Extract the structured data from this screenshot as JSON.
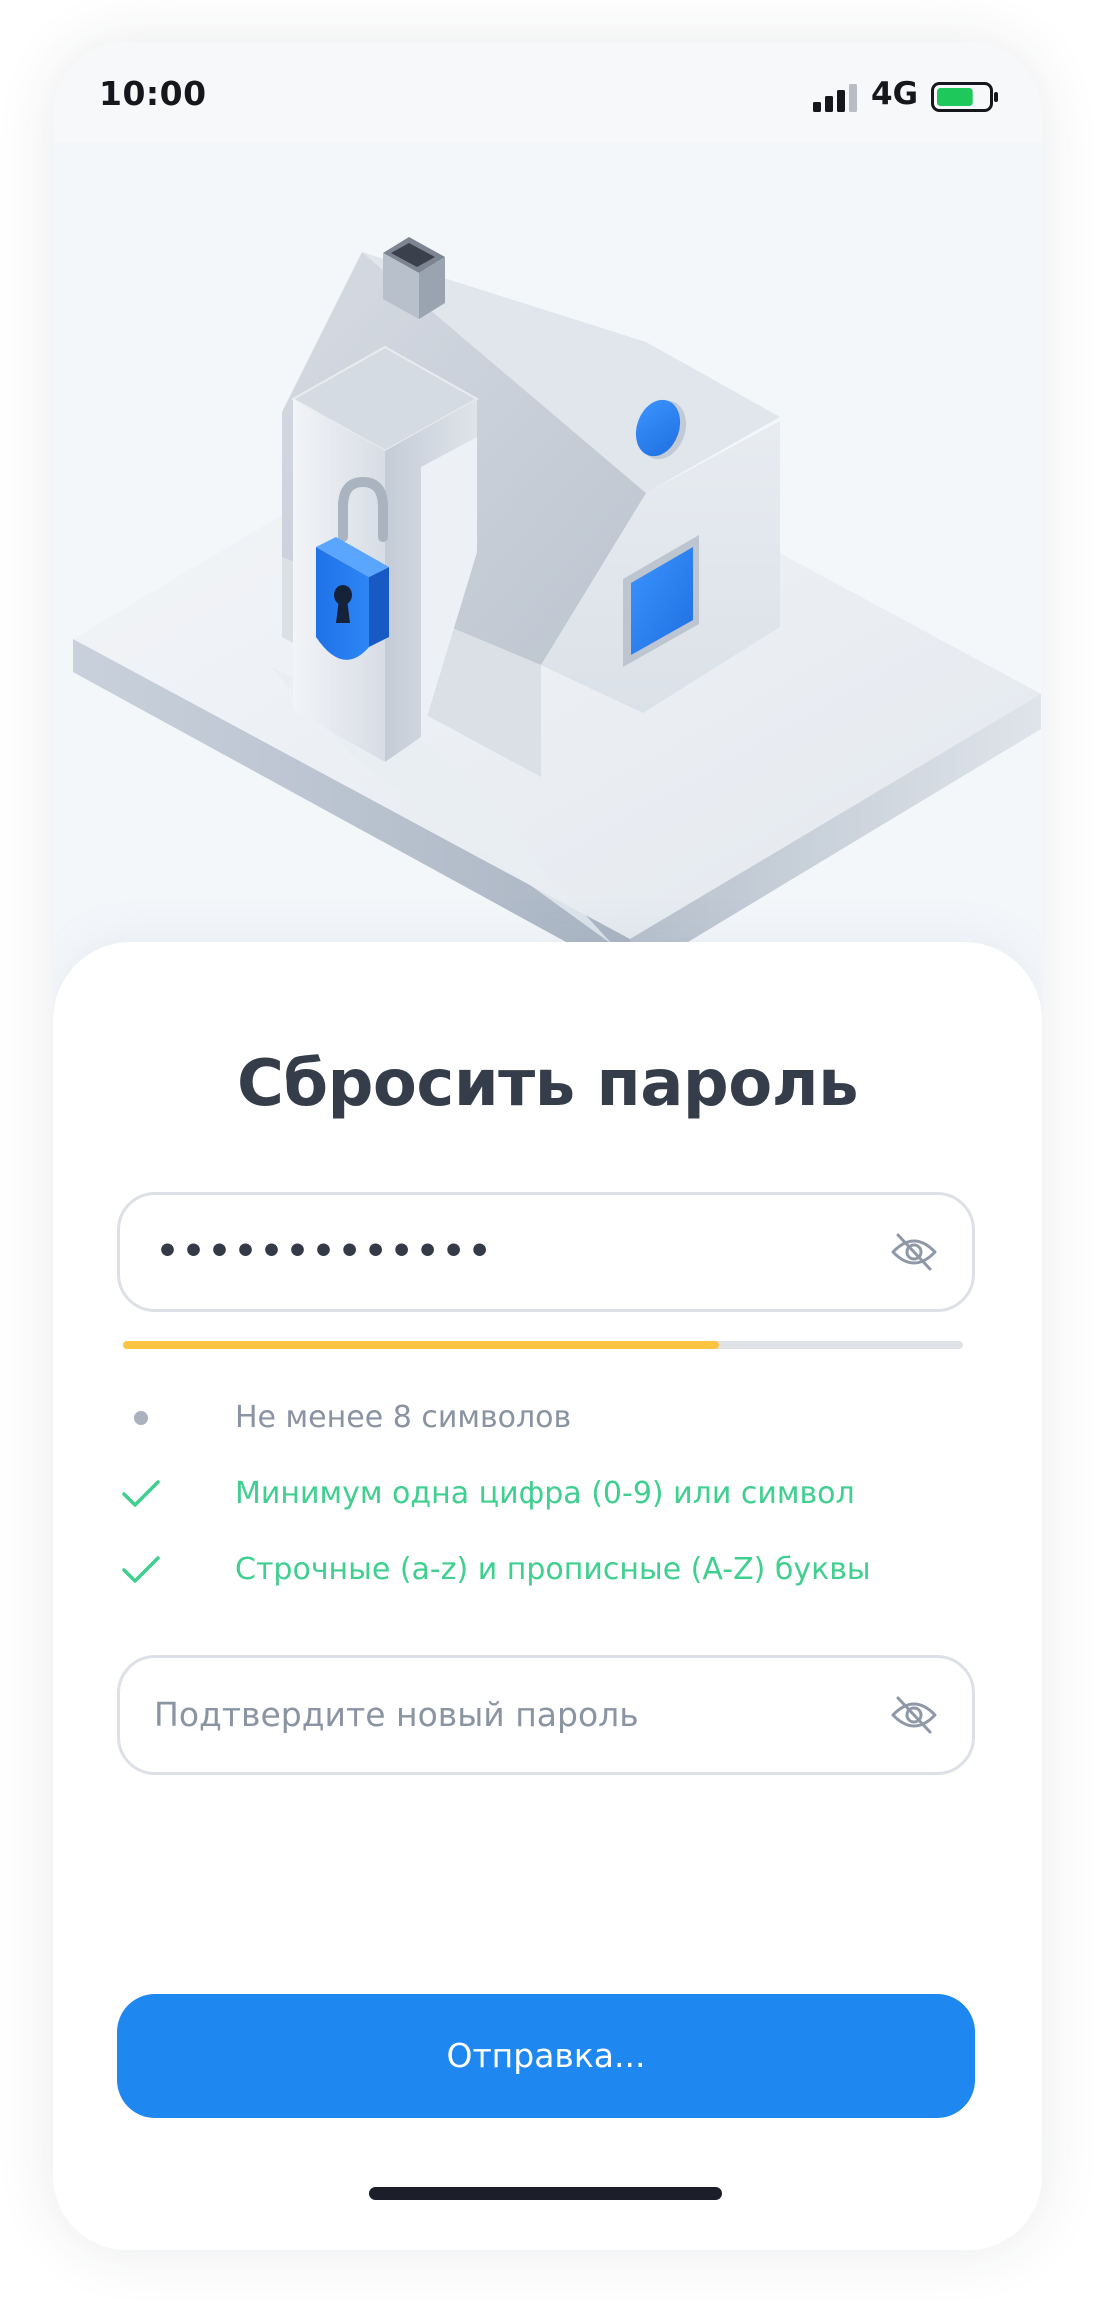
{
  "status_bar": {
    "time": "10:00",
    "network": "4G",
    "battery_level": 0.7,
    "battery_color": "#1fc85a"
  },
  "screen": {
    "title": "Сбросить пароль"
  },
  "new_password": {
    "value": "•••••••••••••",
    "visibility_icon": "eye-off-icon",
    "strength": 0.71,
    "strength_color": "#fdc441"
  },
  "requirements": [
    {
      "text": "Не менее 8 символов",
      "status": "pending"
    },
    {
      "text": "Минимум одна цифра (0-9) или символ",
      "status": "done"
    },
    {
      "text": "Строчные (a-z) и прописные (A-Z) буквы",
      "status": "done"
    }
  ],
  "confirm_password": {
    "placeholder": "Подтвердите новый пароль",
    "visibility_icon": "eye-off-icon"
  },
  "submit_button": {
    "label": "Отправка...",
    "color": "#1e87f0"
  }
}
